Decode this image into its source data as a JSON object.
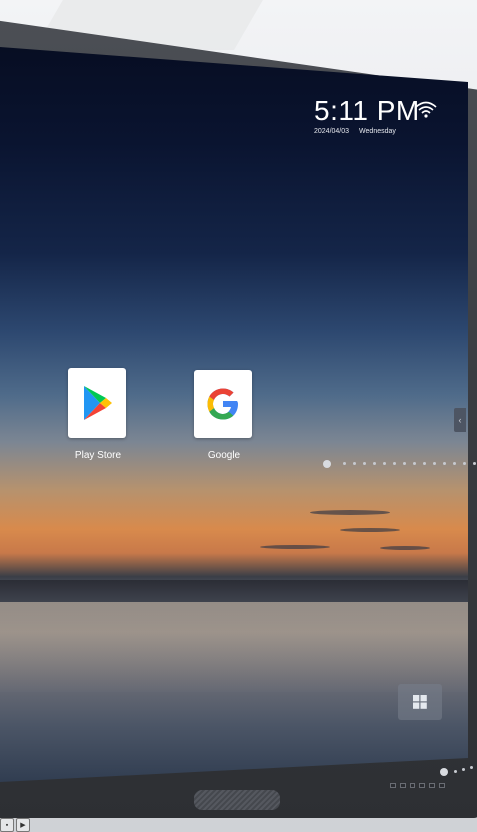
{
  "status": {
    "time": "5:11 PM",
    "date": "2024/04/03",
    "weekday": "Wednesday",
    "wifi_icon": "wifi-icon"
  },
  "apps": [
    {
      "label": "Play Store",
      "icon": "play-store-icon"
    },
    {
      "label": "Google",
      "icon": "google-icon"
    }
  ],
  "controls": {
    "windows_button_icon": "windows-icon",
    "side_handle_icon": "chevron-left-icon"
  },
  "colors": {
    "bezel": "#3a3d42",
    "screen_top": "#050a1c",
    "sunset": "#d88a4c",
    "text": "#ffffff"
  }
}
